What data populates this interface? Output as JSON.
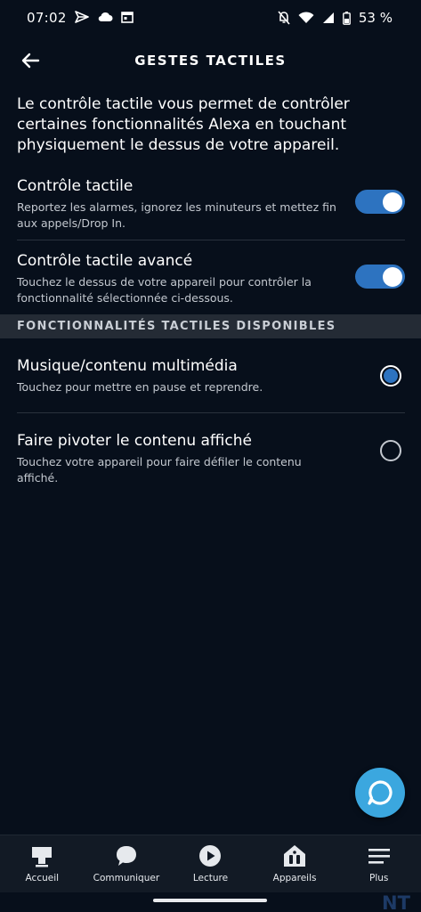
{
  "status_bar": {
    "time": "07:02",
    "battery": "53 %"
  },
  "header": {
    "title": "GESTES TACTILES"
  },
  "intro": "Le contrôle tactile vous permet de contrôler certaines fonctionnalités Alexa en touchant physiquement le dessus de votre appareil.",
  "settings": [
    {
      "title": "Contrôle tactile",
      "description": "Reportez les alarmes, ignorez les minuteurs et mettez fin aux appels/Drop In.",
      "enabled": true
    },
    {
      "title": "Contrôle tactile avancé",
      "description": "Touchez le dessus de votre appareil pour contrôler la fonctionnalité sélectionnée ci-dessous.",
      "enabled": true
    }
  ],
  "section_header": "FONCTIONNALITÉS TACTILES DISPONIBLES",
  "options": [
    {
      "title": "Musique/contenu multimédia",
      "description": "Touchez pour mettre en pause et reprendre.",
      "selected": true
    },
    {
      "title": "Faire pivoter le contenu affiché",
      "description": "Touchez votre appareil pour faire défiler le contenu affiché.",
      "selected": false
    }
  ],
  "nav": [
    {
      "label": "Accueil",
      "icon": "home-icon"
    },
    {
      "label": "Communiquer",
      "icon": "chat-bubble-icon"
    },
    {
      "label": "Lecture",
      "icon": "play-icon"
    },
    {
      "label": "Appareils",
      "icon": "devices-icon"
    },
    {
      "label": "Plus",
      "icon": "menu-icon"
    }
  ],
  "watermark": "NT",
  "colors": {
    "background": "#070f1b",
    "accent": "#2d73c0",
    "alexa": "#3ba7df",
    "section_bg": "#242b35"
  }
}
